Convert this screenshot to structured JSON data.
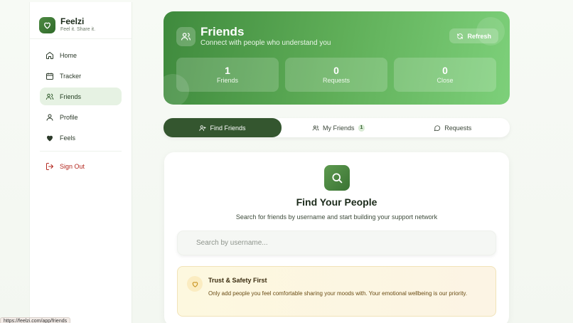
{
  "brand": {
    "name": "Feelzi",
    "tagline": "Feel it. Share it."
  },
  "sidebar": {
    "items": [
      {
        "label": "Home",
        "icon": "home-icon"
      },
      {
        "label": "Tracker",
        "icon": "calendar-icon"
      },
      {
        "label": "Friends",
        "icon": "users-icon",
        "active": true
      },
      {
        "label": "Profile",
        "icon": "user-icon"
      },
      {
        "label": "Feels",
        "icon": "heart-icon"
      }
    ],
    "signout": {
      "label": "Sign Out",
      "icon": "logout-icon"
    }
  },
  "status_url": "https://feelzi.com/app/friends",
  "hero": {
    "title": "Friends",
    "subtitle": "Connect with people who understand you",
    "refresh_label": "Refresh",
    "stats": [
      {
        "value": "1",
        "label": "Friends"
      },
      {
        "value": "0",
        "label": "Requests"
      },
      {
        "value": "0",
        "label": "Close"
      }
    ]
  },
  "tabs": [
    {
      "label": "Find Friends",
      "icon": "user-plus-icon",
      "active": true
    },
    {
      "label": "My Friends",
      "icon": "users-icon",
      "badge": "1"
    },
    {
      "label": "Requests",
      "icon": "message-circle-icon"
    }
  ],
  "find": {
    "title": "Find Your People",
    "subtitle": "Search for friends by username and start building your support network",
    "search_placeholder": "Search by username..."
  },
  "notice": {
    "title": "Trust & Safety First",
    "body": "Only add people you feel comfortable sharing your moods with. Your emotional wellbeing is our priority."
  },
  "colors": {
    "accent": "#34562f",
    "hero_start": "#3f8a3d",
    "hero_end": "#7dd07a",
    "signout": "#b3271e",
    "notice_bg": "#fdf8df"
  }
}
